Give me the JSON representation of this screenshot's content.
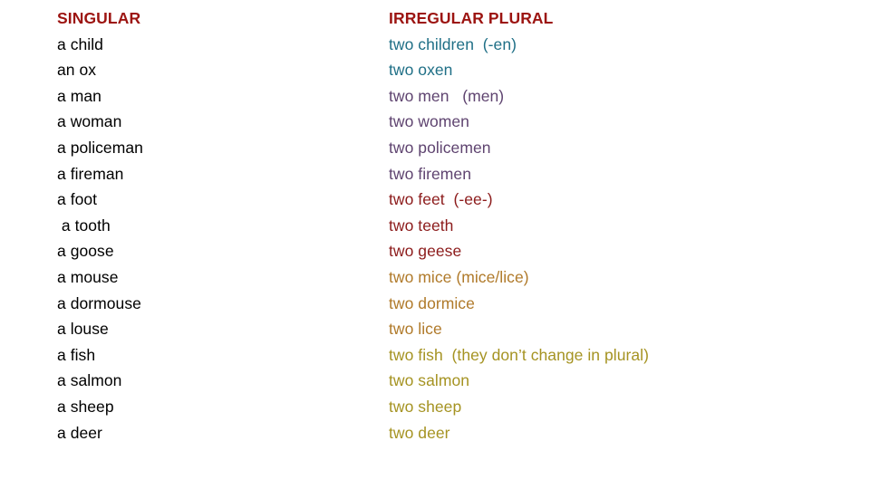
{
  "slide": {
    "background_color": "#ffffff",
    "header_color": "#9C1411",
    "columns": {
      "singular": {
        "header": "SINGULAR",
        "text_color": "#000000",
        "items": [
          {
            "label": "a child"
          },
          {
            "label": "an ox"
          },
          {
            "label": "a man"
          },
          {
            "label": "a woman"
          },
          {
            "label": "a policeman"
          },
          {
            "label": "a fireman"
          },
          {
            "label": "a foot"
          },
          {
            "label": " a tooth"
          },
          {
            "label": "a goose"
          },
          {
            "label": "a mouse"
          },
          {
            "label": "a dormouse"
          },
          {
            "label": "a louse"
          },
          {
            "label": "a fish"
          },
          {
            "label": "a salmon"
          },
          {
            "label": "a sheep"
          },
          {
            "label": "a deer"
          }
        ]
      },
      "plural": {
        "header": "IRREGULAR PLURAL",
        "items": [
          {
            "label": "two children  (-en)",
            "color": "#1F6F86"
          },
          {
            "label": "two oxen",
            "color": "#1F6F86"
          },
          {
            "label": "two men   (men)",
            "color": "#5F4470"
          },
          {
            "label": "two women",
            "color": "#5F4470"
          },
          {
            "label": "two policemen",
            "color": "#5F4470"
          },
          {
            "label": "two firemen",
            "color": "#5F4470"
          },
          {
            "label": "two feet  (-ee-)",
            "color": "#8C1B1B"
          },
          {
            "label": "two teeth",
            "color": "#8C1B1B"
          },
          {
            "label": "two geese",
            "color": "#8C1B1B"
          },
          {
            "label": "two mice (mice/lice)",
            "color": "#B07A2A"
          },
          {
            "label": "two dormice",
            "color": "#B07A2A"
          },
          {
            "label": "two lice",
            "color": "#B07A2A"
          },
          {
            "label": "two fish  (they don’t change in plural)",
            "color": "#A59322"
          },
          {
            "label": "two salmon",
            "color": "#A59322"
          },
          {
            "label": "two sheep",
            "color": "#A59322"
          },
          {
            "label": "two deer",
            "color": "#A59322"
          }
        ]
      }
    }
  }
}
